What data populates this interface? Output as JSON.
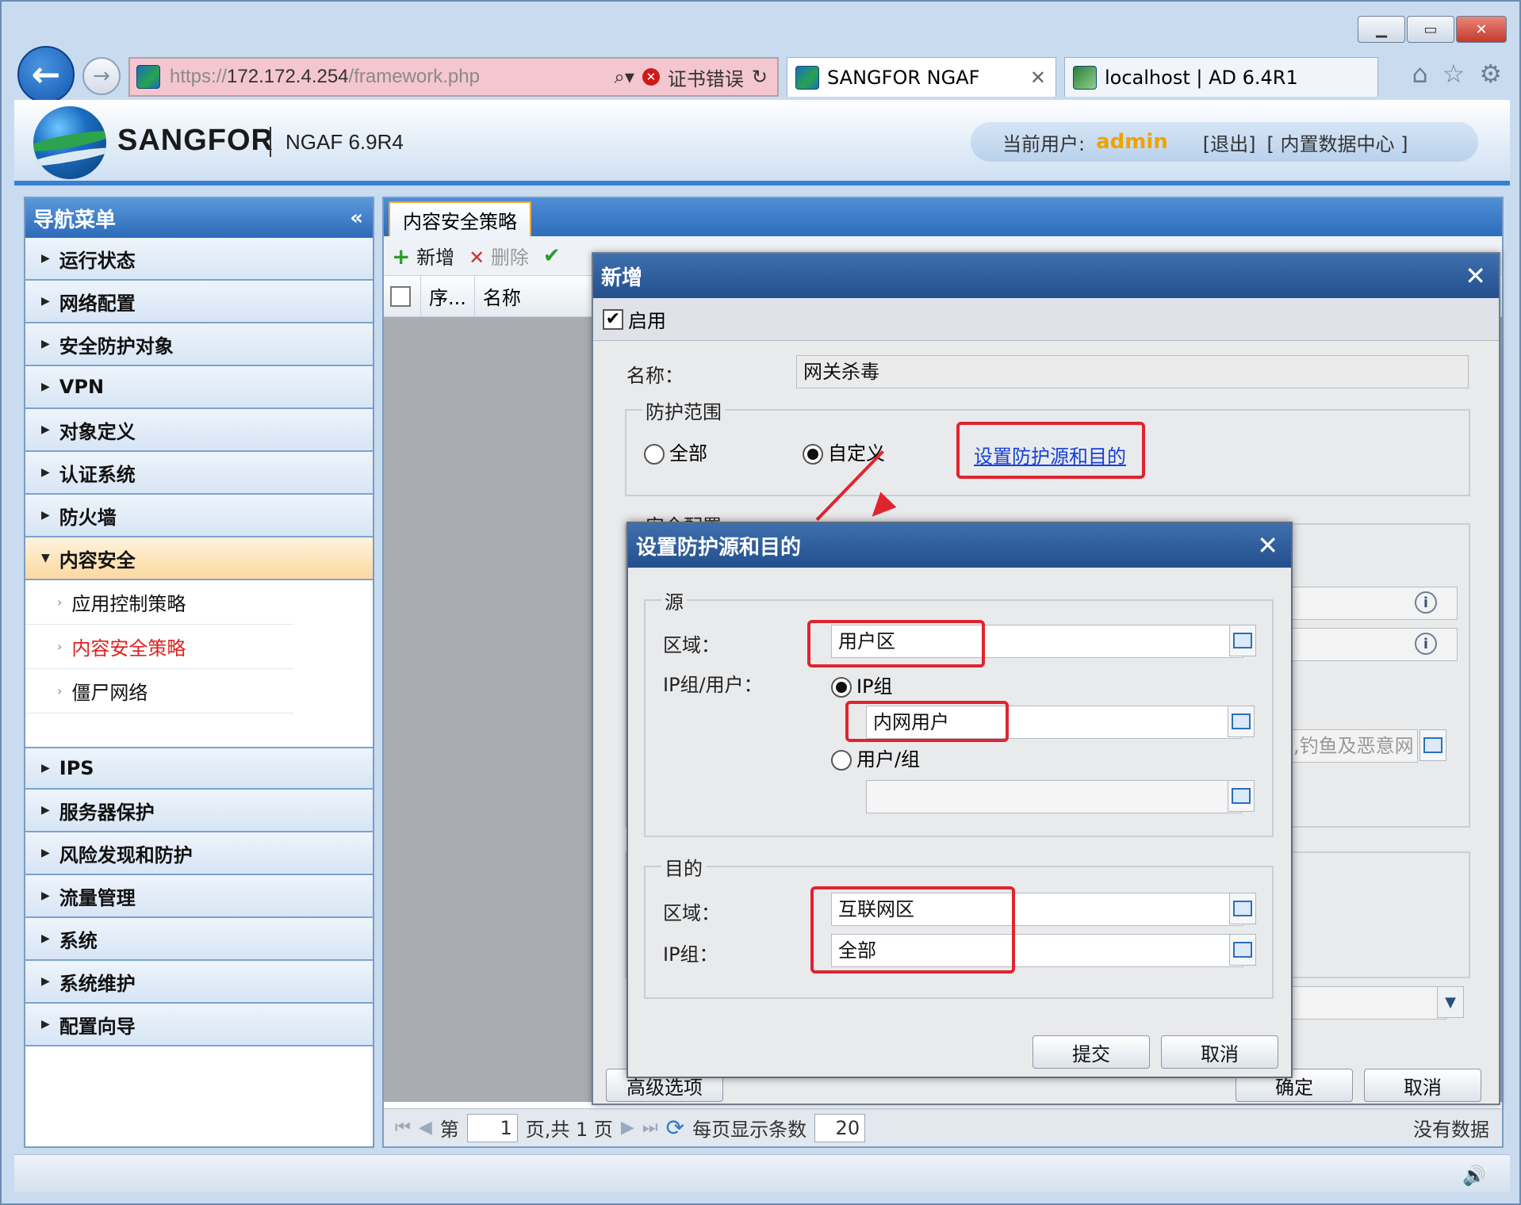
{
  "browser": {
    "url_scheme": "https://",
    "url_host": "172.172.4.254",
    "url_path": "/framework.php",
    "cert_error": "证书错误",
    "tabs": [
      {
        "label": "SANGFOR NGAF"
      },
      {
        "label": "localhost | AD 6.4R1"
      }
    ]
  },
  "header": {
    "brand": "SANGFOR",
    "version": "NGAF 6.9R4",
    "current_user_label": "当前用户:",
    "username": "admin",
    "logout": "[退出]",
    "datacenter": "[ 内置数据中心 ]"
  },
  "sidebar": {
    "title": "导航菜单",
    "items_top": [
      {
        "label": "运行状态"
      },
      {
        "label": "网络配置"
      },
      {
        "label": "安全防护对象"
      },
      {
        "label": "VPN"
      },
      {
        "label": "对象定义"
      },
      {
        "label": "认证系统"
      },
      {
        "label": "防火墙"
      }
    ],
    "open_item": "内容安全",
    "sub_items": [
      {
        "label": "应用控制策略"
      },
      {
        "label": "内容安全策略"
      },
      {
        "label": "僵尸网络"
      }
    ],
    "items_bottom": [
      {
        "label": "IPS"
      },
      {
        "label": "服务器保护"
      },
      {
        "label": "风险发现和防护"
      },
      {
        "label": "流量管理"
      },
      {
        "label": "系统"
      },
      {
        "label": "系统维护"
      },
      {
        "label": "配置向导"
      }
    ]
  },
  "main": {
    "tab": "内容安全策略",
    "toolbar": {
      "add": "新增",
      "delete": "删除"
    },
    "columns": {
      "seq": "序...",
      "name": "名称"
    },
    "pager": {
      "page_prefix": "第",
      "page_value": "1",
      "page_suffix": "页,共 1 页",
      "per_page_label": "每页显示条数",
      "per_page_value": "20",
      "no_data": "没有数据"
    }
  },
  "dialog_add": {
    "title": "新增",
    "enable_label": "启用",
    "name_label": "名称：",
    "name_value": "网关杀毒",
    "scope_legend": "防护范围",
    "scope_all": "全部",
    "scope_custom": "自定义",
    "set_link": "设置防护源和目的",
    "security_legend": "安全配置",
    "partial_text": "客,钓鱼及恶意网",
    "advanced_button": "高级选项",
    "ok_button": "确定",
    "cancel_button": "取消"
  },
  "dialog_src_dst": {
    "title": "设置防护源和目的",
    "source_legend": "源",
    "zone_label": "区域：",
    "src_zone_value": "用户区",
    "ipgroup_user_label": "IP组/用户：",
    "ipgroup_radio": "IP组",
    "src_ipgroup_value": "内网用户",
    "user_group_radio": "用户/组",
    "user_group_value": "",
    "dest_legend": "目的",
    "dst_zone_label": "区域：",
    "dst_zone_value": "互联网区",
    "dst_ipgroup_label": "IP组：",
    "dst_ipgroup_value": "全部",
    "submit_button": "提交",
    "cancel_button": "取消"
  }
}
